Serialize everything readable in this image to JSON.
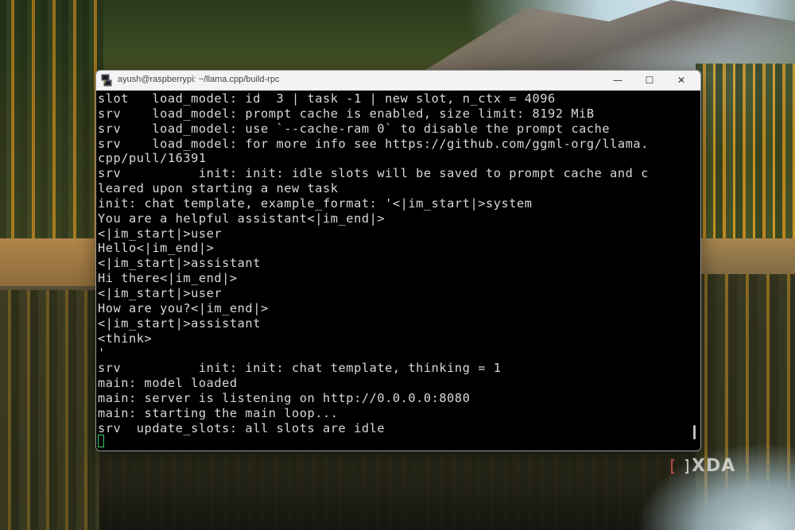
{
  "window": {
    "title": "ayush@raspberrypi: ~/llama.cpp/build-rpc",
    "controls": {
      "minimize": "—",
      "maximize": "☐",
      "close": "✕"
    }
  },
  "terminal": {
    "lines": [
      "slot   load_model: id  3 | task -1 | new slot, n_ctx = 4096",
      "srv    load_model: prompt cache is enabled, size limit: 8192 MiB",
      "srv    load_model: use `--cache-ram 0` to disable the prompt cache",
      "srv    load_model: for more info see https://github.com/ggml-org/llama.",
      "cpp/pull/16391",
      "srv          init: init: idle slots will be saved to prompt cache and c",
      "leared upon starting a new task",
      "init: chat template, example_format: '<|im_start|>system",
      "You are a helpful assistant<|im_end|>",
      "<|im_start|>user",
      "Hello<|im_end|>",
      "<|im_start|>assistant",
      "Hi there<|im_end|>",
      "<|im_start|>user",
      "How are you?<|im_end|>",
      "<|im_start|>assistant",
      "<think>",
      "'",
      "srv          init: init: chat template, thinking = 1",
      "main: model loaded",
      "main: server is listening on http://0.0.0.0:8080",
      "main: starting the main loop...",
      "srv  update_slots: all slots are idle"
    ]
  },
  "watermark": {
    "text": "XDA"
  },
  "colors": {
    "terminal_bg": "#000000",
    "terminal_fg": "#d8d8d8",
    "cursor": "#3ccf6a",
    "titlebar_bg": "#f3f3f3"
  }
}
